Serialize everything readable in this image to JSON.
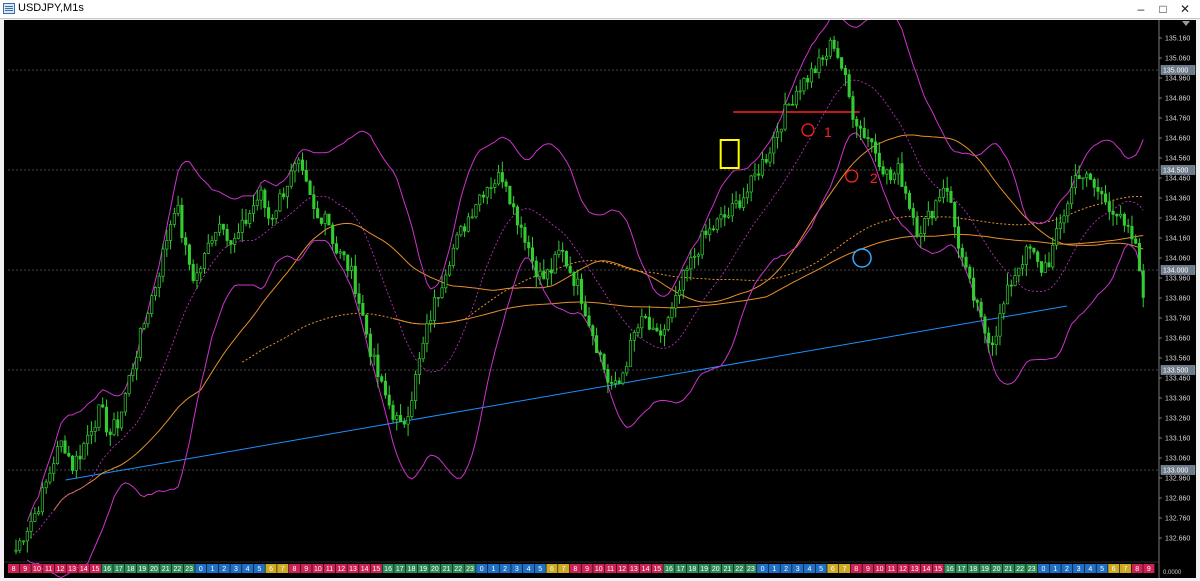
{
  "window": {
    "title": "USDJPY,M1s",
    "minimize_glyph": "–",
    "maximize_glyph": "□",
    "close_glyph": "✕"
  },
  "colors": {
    "background": "#000000",
    "candles": "#33cc33",
    "trendline": "#1e90ff",
    "bollinger": "#cc33cc",
    "ma_slow": "#e6902a",
    "marker_red": "#ff2020",
    "marker_yellow": "#ffff00",
    "marker_blue": "#33aaff"
  },
  "chart_data": {
    "type": "candlestick",
    "symbol": "USDJPY",
    "timeframe": "M1s",
    "ylim": [
      132.55,
      135.22
    ],
    "y_ticks": [
      "135.160",
      "135.060",
      "134.960",
      "134.860",
      "134.760",
      "134.660",
      "134.560",
      "134.460",
      "134.360",
      "134.260",
      "134.160",
      "134.060",
      "133.960",
      "133.860",
      "133.760",
      "133.660",
      "133.560",
      "133.460",
      "133.360",
      "133.260",
      "133.160",
      "133.060",
      "132.960",
      "132.860",
      "132.760",
      "132.660"
    ],
    "level_lines": [
      {
        "label": "135.000",
        "price": 135.0
      },
      {
        "label": "134.500",
        "price": 134.5
      },
      {
        "label": "134.000",
        "price": 134.0
      },
      {
        "label": "133.500",
        "price": 133.5
      },
      {
        "label": "133.000",
        "price": 133.0
      }
    ],
    "last_price_label": "0.0000",
    "closes": [
      132.6,
      132.7,
      132.78,
      132.9,
      133.05,
      133.15,
      133.02,
      133.1,
      133.22,
      133.3,
      133.18,
      133.25,
      133.45,
      133.62,
      133.8,
      133.95,
      134.15,
      134.35,
      134.1,
      133.95,
      134.05,
      134.2,
      134.25,
      134.12,
      134.2,
      134.3,
      134.38,
      134.25,
      134.35,
      134.45,
      134.52,
      134.4,
      134.25,
      134.3,
      134.1,
      134.05,
      133.95,
      133.75,
      133.55,
      133.4,
      133.3,
      133.2,
      133.35,
      133.55,
      133.75,
      133.9,
      134.05,
      134.15,
      134.25,
      134.35,
      134.42,
      134.45,
      134.48,
      134.3,
      134.2,
      134.05,
      133.95,
      134.0,
      134.1,
      134.0,
      133.9,
      133.75,
      133.6,
      133.45,
      133.4,
      133.55,
      133.7,
      133.75,
      133.65,
      133.7,
      133.8,
      133.95,
      134.05,
      134.15,
      134.2,
      134.25,
      134.28,
      134.35,
      134.4,
      134.5,
      134.58,
      134.7,
      134.8,
      134.9,
      134.95,
      135.0,
      135.05,
      135.15,
      135.0,
      134.8,
      134.7,
      134.65,
      134.55,
      134.45,
      134.5,
      134.35,
      134.2,
      134.25,
      134.35,
      134.45,
      134.2,
      134.0,
      133.85,
      133.7,
      133.65,
      133.8,
      133.95,
      134.05,
      134.1,
      134.0,
      134.05,
      134.2,
      134.35,
      134.5,
      134.45,
      134.4,
      134.35,
      134.3,
      134.2,
      134.15,
      133.9
    ],
    "overlays": [
      {
        "name": "Trendline",
        "x": [
          0.05,
          0.92
        ],
        "y": [
          132.95,
          133.82
        ]
      },
      {
        "name": "Resistance",
        "x": [
          0.63,
          0.74
        ],
        "y": [
          134.79,
          134.79
        ]
      }
    ],
    "annotations": [
      {
        "text": "1",
        "x": 0.695,
        "price": 134.69
      },
      {
        "text": "2",
        "x": 0.735,
        "price": 134.46
      }
    ],
    "markers": [
      {
        "kind": "red-circle",
        "x": 0.695,
        "price": 134.7
      },
      {
        "kind": "red-circle",
        "x": 0.733,
        "price": 134.47
      },
      {
        "kind": "blue-circle",
        "x": 0.742,
        "price": 134.06
      },
      {
        "kind": "yellow-box",
        "x": 0.627,
        "price": 134.58
      }
    ],
    "time_axis": [
      {
        "label": "8",
        "color": "#cc2255"
      },
      {
        "label": "9",
        "color": "#cc2255"
      },
      {
        "label": "10",
        "color": "#cc2255"
      },
      {
        "label": "11",
        "color": "#cc2255"
      },
      {
        "label": "12",
        "color": "#cc2255"
      },
      {
        "label": "13",
        "color": "#cc2255"
      },
      {
        "label": "14",
        "color": "#cc2255"
      },
      {
        "label": "15",
        "color": "#cc2255"
      },
      {
        "label": "16",
        "color": "#2e8b57"
      },
      {
        "label": "17",
        "color": "#2e8b57"
      },
      {
        "label": "18",
        "color": "#2e8b57"
      },
      {
        "label": "19",
        "color": "#2e8b57"
      },
      {
        "label": "20",
        "color": "#2e8b57"
      },
      {
        "label": "21",
        "color": "#2e8b57"
      },
      {
        "label": "22",
        "color": "#2e8b57"
      },
      {
        "label": "23",
        "color": "#2e8b57"
      },
      {
        "label": "0",
        "color": "#1f6fc5"
      },
      {
        "label": "1",
        "color": "#1f6fc5"
      },
      {
        "label": "2",
        "color": "#1f6fc5"
      },
      {
        "label": "3",
        "color": "#1f6fc5"
      },
      {
        "label": "4",
        "color": "#1f6fc5"
      },
      {
        "label": "5",
        "color": "#1f6fc5"
      },
      {
        "label": "6",
        "color": "#ccaa22"
      },
      {
        "label": "7",
        "color": "#ccaa22"
      },
      {
        "label": "8",
        "color": "#cc2255"
      },
      {
        "label": "9",
        "color": "#cc2255"
      },
      {
        "label": "10",
        "color": "#cc2255"
      },
      {
        "label": "11",
        "color": "#cc2255"
      },
      {
        "label": "12",
        "color": "#cc2255"
      },
      {
        "label": "13",
        "color": "#cc2255"
      },
      {
        "label": "14",
        "color": "#cc2255"
      },
      {
        "label": "15",
        "color": "#cc2255"
      },
      {
        "label": "16",
        "color": "#2e8b57"
      },
      {
        "label": "17",
        "color": "#2e8b57"
      },
      {
        "label": "18",
        "color": "#2e8b57"
      },
      {
        "label": "19",
        "color": "#2e8b57"
      },
      {
        "label": "20",
        "color": "#2e8b57"
      },
      {
        "label": "21",
        "color": "#2e8b57"
      },
      {
        "label": "22",
        "color": "#2e8b57"
      },
      {
        "label": "23",
        "color": "#2e8b57"
      },
      {
        "label": "0",
        "color": "#1f6fc5"
      },
      {
        "label": "1",
        "color": "#1f6fc5"
      },
      {
        "label": "2",
        "color": "#1f6fc5"
      },
      {
        "label": "3",
        "color": "#1f6fc5"
      },
      {
        "label": "4",
        "color": "#1f6fc5"
      },
      {
        "label": "5",
        "color": "#1f6fc5"
      },
      {
        "label": "6",
        "color": "#ccaa22"
      },
      {
        "label": "7",
        "color": "#ccaa22"
      },
      {
        "label": "8",
        "color": "#cc2255"
      },
      {
        "label": "9",
        "color": "#cc2255"
      },
      {
        "label": "10",
        "color": "#cc2255"
      },
      {
        "label": "11",
        "color": "#cc2255"
      },
      {
        "label": "12",
        "color": "#cc2255"
      },
      {
        "label": "13",
        "color": "#cc2255"
      },
      {
        "label": "14",
        "color": "#cc2255"
      },
      {
        "label": "15",
        "color": "#cc2255"
      },
      {
        "label": "16",
        "color": "#2e8b57"
      },
      {
        "label": "17",
        "color": "#2e8b57"
      },
      {
        "label": "18",
        "color": "#2e8b57"
      },
      {
        "label": "19",
        "color": "#2e8b57"
      },
      {
        "label": "20",
        "color": "#2e8b57"
      },
      {
        "label": "21",
        "color": "#2e8b57"
      },
      {
        "label": "22",
        "color": "#2e8b57"
      },
      {
        "label": "23",
        "color": "#2e8b57"
      },
      {
        "label": "0",
        "color": "#1f6fc5"
      },
      {
        "label": "1",
        "color": "#1f6fc5"
      },
      {
        "label": "2",
        "color": "#1f6fc5"
      },
      {
        "label": "3",
        "color": "#1f6fc5"
      },
      {
        "label": "4",
        "color": "#1f6fc5"
      },
      {
        "label": "5",
        "color": "#1f6fc5"
      },
      {
        "label": "6",
        "color": "#ccaa22"
      },
      {
        "label": "7",
        "color": "#ccaa22"
      },
      {
        "label": "8",
        "color": "#cc2255"
      },
      {
        "label": "9",
        "color": "#cc2255"
      },
      {
        "label": "10",
        "color": "#cc2255"
      },
      {
        "label": "11",
        "color": "#cc2255"
      },
      {
        "label": "12",
        "color": "#cc2255"
      },
      {
        "label": "13",
        "color": "#cc2255"
      },
      {
        "label": "14",
        "color": "#cc2255"
      },
      {
        "label": "15",
        "color": "#cc2255"
      },
      {
        "label": "16",
        "color": "#2e8b57"
      },
      {
        "label": "17",
        "color": "#2e8b57"
      },
      {
        "label": "18",
        "color": "#2e8b57"
      },
      {
        "label": "19",
        "color": "#2e8b57"
      },
      {
        "label": "20",
        "color": "#2e8b57"
      },
      {
        "label": "21",
        "color": "#2e8b57"
      },
      {
        "label": "22",
        "color": "#2e8b57"
      },
      {
        "label": "23",
        "color": "#2e8b57"
      },
      {
        "label": "0",
        "color": "#1f6fc5"
      },
      {
        "label": "1",
        "color": "#1f6fc5"
      },
      {
        "label": "2",
        "color": "#1f6fc5"
      },
      {
        "label": "3",
        "color": "#1f6fc5"
      },
      {
        "label": "4",
        "color": "#1f6fc5"
      },
      {
        "label": "5",
        "color": "#1f6fc5"
      },
      {
        "label": "6",
        "color": "#ccaa22"
      },
      {
        "label": "7",
        "color": "#ccaa22"
      },
      {
        "label": "8",
        "color": "#cc2255"
      },
      {
        "label": "9",
        "color": "#cc2255"
      }
    ]
  }
}
